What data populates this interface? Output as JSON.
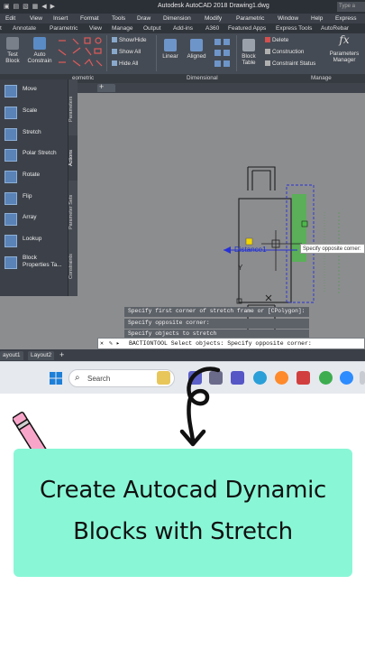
{
  "app": {
    "window_title": "Autodesk AutoCAD 2018    Drawing1.dwg",
    "search_placeholder": "Type a"
  },
  "menubar": [
    "Edit",
    "View",
    "Insert",
    "Format",
    "Tools",
    "Draw",
    "Dimension",
    "Modify",
    "Parametric",
    "Window",
    "Help",
    "Express"
  ],
  "ribbon_tabs": [
    "t",
    "Annotate",
    "Parametric",
    "View",
    "Manage",
    "Output",
    "Add-ins",
    "A360",
    "Featured Apps",
    "Express Tools",
    "AutoRebar"
  ],
  "ribbon": {
    "test_block": "Test\nBlock",
    "test_block_l1": "Test",
    "test_block_l2": "Block",
    "auto_constrain_l1": "Auto",
    "auto_constrain_l2": "Constrain",
    "show_hide": "Show/Hide",
    "show_all": "Show All",
    "hide_all": "Hide All",
    "linear": "Linear",
    "aligned": "Aligned",
    "block_table_l1": "Block",
    "block_table_l2": "Table",
    "delete": "Delete",
    "construction": "Construction",
    "constraint_status": "Constraint Status",
    "parameters_manager_l1": "Parameters",
    "parameters_manager_l2": "Manager",
    "fx": "fx"
  },
  "panels": [
    "eometric",
    "Dimensional",
    "Manage"
  ],
  "palette": {
    "items": [
      "Move",
      "Scale",
      "Stretch",
      "Polar Stretch",
      "Rotate",
      "Flip",
      "Array",
      "Lookup"
    ],
    "last_item_l1": "Block",
    "last_item_l2": "Properties Ta...",
    "side_tabs": [
      "Parameters",
      "Actions",
      "Parameter Sets",
      "Constraints"
    ]
  },
  "drawing": {
    "distance_label": "Distance1",
    "tooltip": "Specify opposite corner:",
    "y_label": "Y",
    "x_label": "X"
  },
  "command": {
    "history": [
      "Specify first corner of stretch frame or [CPolygon]:",
      "Specify opposite corner:",
      "Specify objects to stretch"
    ],
    "prompt": "BACTIONTOOL Select objects: Specify opposite corner:"
  },
  "layout_tabs": [
    "ayout1",
    "Layout2"
  ],
  "taskbar": {
    "search_label": "Search"
  },
  "banner": {
    "line1": "Create Autocad Dynamic",
    "line2": "Blocks with Stretch"
  },
  "colors": {
    "banner_bg": "#89f7d6",
    "acad_dark": "#3a3f47",
    "drawing_bg": "#8c8d8f",
    "stretch_highlight": "#4db84a",
    "pencil_pink": "#f7a6c9"
  }
}
